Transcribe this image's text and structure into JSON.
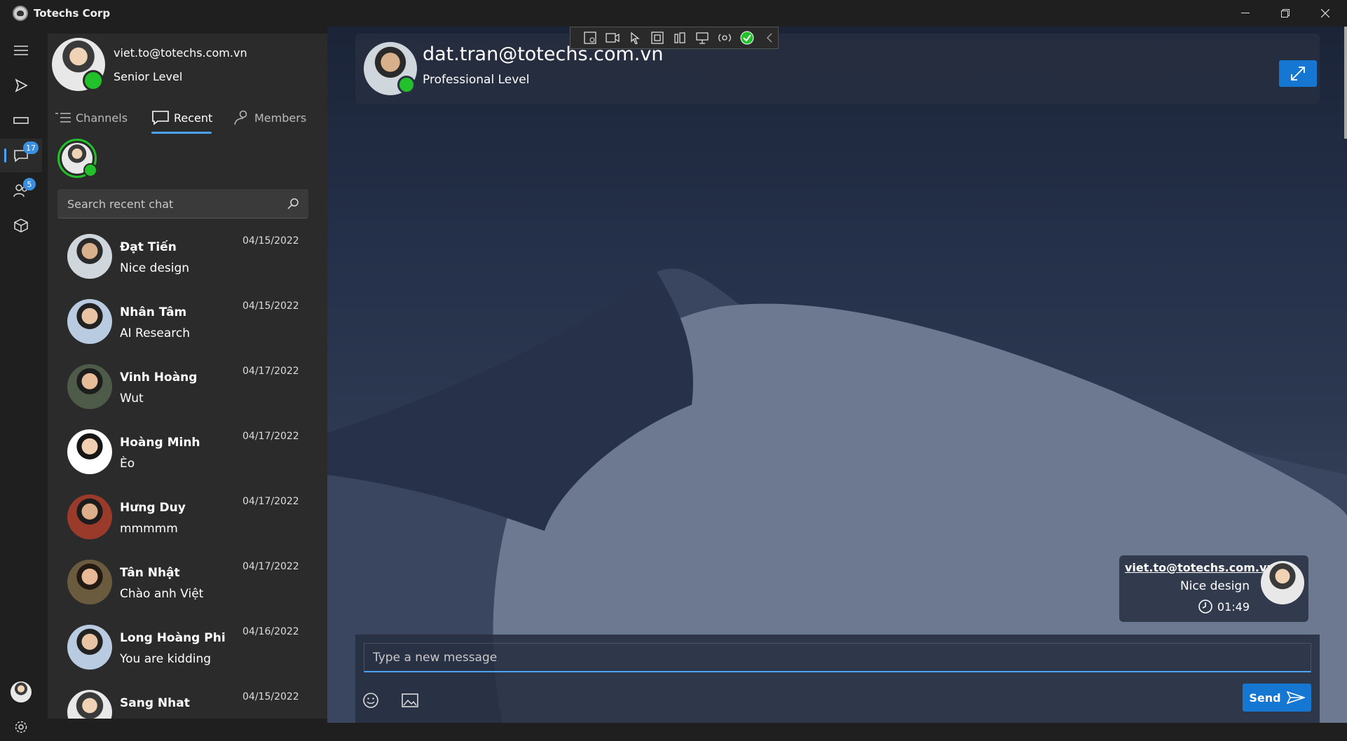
{
  "window": {
    "title": "Totechs Corp"
  },
  "rail": {
    "chat_badge": "17",
    "members_badge": "5"
  },
  "profile": {
    "email": "viet.to@totechs.com.vn",
    "level": "Senior Level"
  },
  "tabs": [
    {
      "label": "Channels"
    },
    {
      "label": "Recent"
    },
    {
      "label": "Members"
    }
  ],
  "search": {
    "placeholder": "Search recent chat"
  },
  "chats": [
    {
      "name": "Đạt Tiến",
      "message": "Nice design",
      "date": "04/15/2022"
    },
    {
      "name": "Nhân Tâm",
      "message": "AI Research",
      "date": "04/15/2022"
    },
    {
      "name": "Vinh Hoàng",
      "message": "Wut",
      "date": "04/17/2022"
    },
    {
      "name": "Hoàng Minh",
      "message": "Èo",
      "date": "04/17/2022"
    },
    {
      "name": "Hưng Duy",
      "message": "mmmmm",
      "date": "04/17/2022"
    },
    {
      "name": "Tân Nhật",
      "message": "Chào anh Việt",
      "date": "04/17/2022"
    },
    {
      "name": "Long Hoàng Phi",
      "message": "You are kidding",
      "date": "04/16/2022"
    },
    {
      "name": "Sang Nhat",
      "message": "",
      "date": "04/15/2022"
    }
  ],
  "conversation": {
    "email": "dat.tran@totechs.com.vn",
    "level": "Professional Level"
  },
  "message": {
    "sender": "viet.to@totechs.com.vn",
    "text": "Nice design",
    "time": "01:49"
  },
  "composer": {
    "placeholder": "Type a new message",
    "send_label": "Send"
  },
  "colors": {
    "accent": "#1677d2",
    "online": "#22c02a",
    "sidebar": "#2b2b2b"
  }
}
